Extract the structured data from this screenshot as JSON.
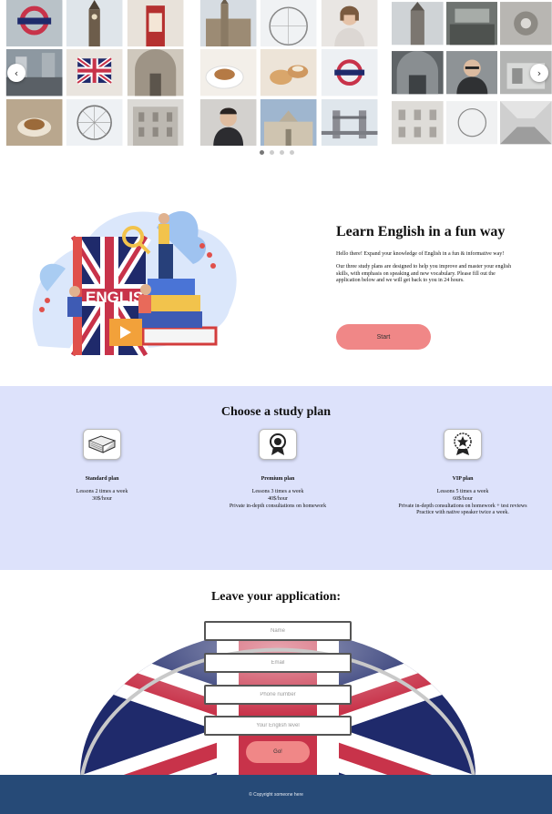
{
  "gallery": {
    "prev_label": "‹",
    "next_label": "›",
    "dots": [
      true,
      false,
      false,
      false
    ]
  },
  "intro": {
    "title": "Learn English in a fun way",
    "paragraph1": "Hello there! Expand your knowledge of English in a fun & informative way!",
    "paragraph2": "Our three study plans are designed to help you improve and master your english skills, with emphasis on speaking and new vocabulary. Please fill out the application below and we will get back to you in 24 hours.",
    "start_label": "Start",
    "illustration_text": "ENGLISH"
  },
  "plans": {
    "title": "Choose a study plan",
    "items": [
      {
        "name": "Standard plan",
        "lines": [
          "Lessons 2 times a week",
          "30$/hour"
        ],
        "icon": "book-icon"
      },
      {
        "name": "Premium plan",
        "lines": [
          "Lessons 3 times a week",
          "40$/hour",
          "Private in-depth consultations on homework"
        ],
        "icon": "badge-icon"
      },
      {
        "name": "VIP plan",
        "lines": [
          "Lessons 5 times a week",
          "60$/hour",
          "Private in-depth consultations on homework + test reviews",
          "Practice with native speaker twice a week."
        ],
        "icon": "star-badge-icon"
      }
    ]
  },
  "application": {
    "title": "Leave your application:",
    "name_placeholder": "Name",
    "email_placeholder": "Email",
    "phone_placeholder": "Phone number",
    "level_placeholder": "Your English level",
    "go_label": "Go!"
  },
  "footer": {
    "copyright": "© Copyright someone here"
  },
  "colors": {
    "accent": "#f08787",
    "plans_bg": "#dde2fb",
    "footer_bg": "#264a77",
    "flag_blue": "#1f2a6b",
    "flag_red": "#c8334a"
  }
}
